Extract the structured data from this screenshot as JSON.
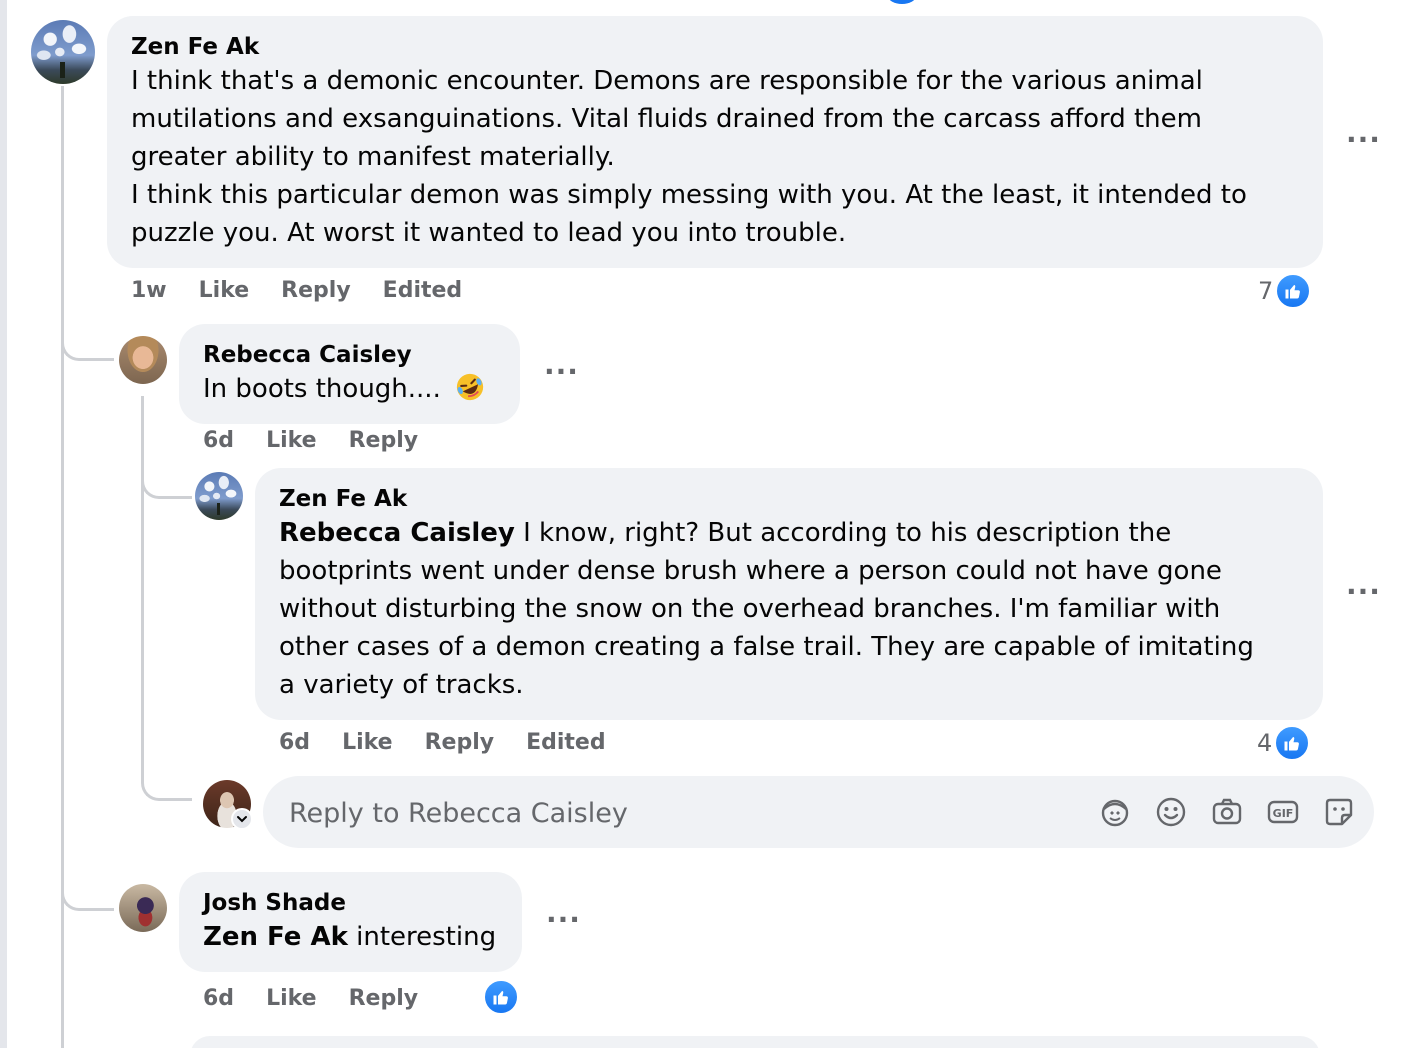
{
  "comments": [
    {
      "author": "Zen Fe Ak",
      "text_lines": [
        "I think that's a demonic encounter. Demons are responsible for the various animal",
        "mutilations and exsanguinations. Vital fluids drained from the carcass afford them",
        "greater ability to manifest materially.",
        "I think this particular demon was simply messing with you. At the least, it intended to",
        "puzzle you. At worst it wanted to lead you into trouble."
      ],
      "time": "1w",
      "like_label": "Like",
      "reply_label": "Reply",
      "edited_label": "Edited",
      "reaction_count": "7",
      "reaction_icon": "thumbs-up-icon",
      "more_icon": "more-options-icon"
    },
    {
      "author": "Rebecca Caisley",
      "text": "In boots though....",
      "emoji": "rolling-on-floor-laughing-emoji",
      "time": "6d",
      "like_label": "Like",
      "reply_label": "Reply"
    },
    {
      "author": "Zen Fe Ak",
      "mention": "Rebecca Caisley",
      "text_first": " I know, right? But according to his description the",
      "text_lines": [
        "bootprints went under dense brush where a person could not have gone",
        "without disturbing the snow on the overhead branches. I'm familiar with",
        "other cases of a demon creating a false trail. They are capable of imitating",
        "a variety of tracks."
      ],
      "time": "6d",
      "like_label": "Like",
      "reply_label": "Reply",
      "edited_label": "Edited",
      "reaction_count": "4"
    },
    {
      "author": "Josh Shade",
      "mention": "Zen Fe Ak",
      "text": " interesting",
      "time": "6d",
      "like_label": "Like",
      "reply_label": "Reply"
    }
  ],
  "reply_box": {
    "placeholder": "Reply to Rebecca Caisley",
    "icons": [
      "avatar-sticker-icon",
      "emoji-icon",
      "camera-icon",
      "gif-icon",
      "sticker-icon"
    ]
  },
  "colors": {
    "bubble": "#f0f2f5",
    "secondary_text": "#65676b",
    "like_blue": "#1877f2"
  }
}
